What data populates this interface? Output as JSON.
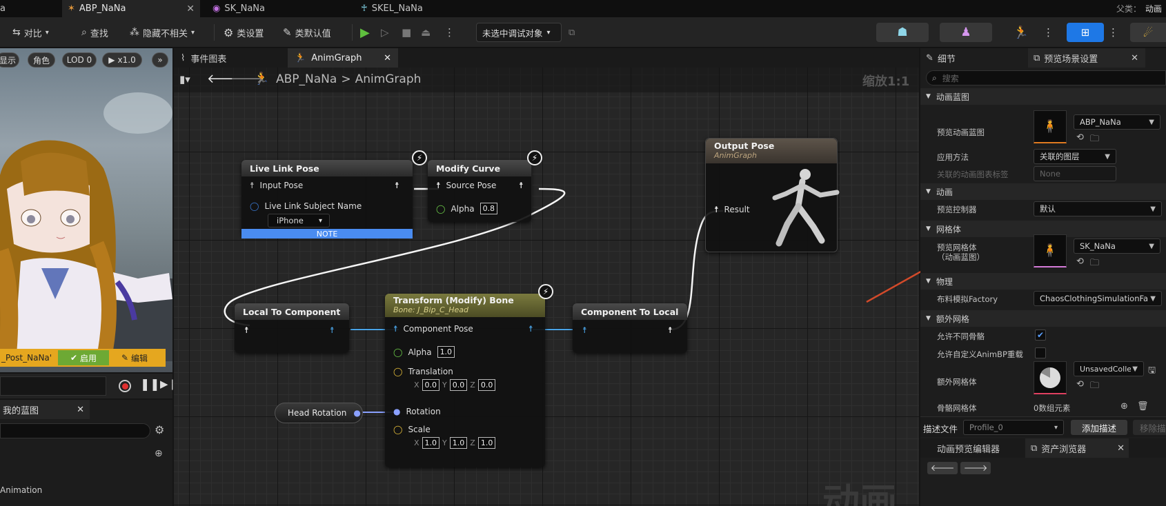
{
  "doc_tabs": [
    {
      "label": "ABP_NaNa"
    },
    {
      "label": "SK_NaNa"
    },
    {
      "label": "SKEL_NaNa"
    }
  ],
  "tab_fragment_left": "a",
  "parent_label": "父类：",
  "parent_value": "动画",
  "toolbar": {
    "compare": "对比",
    "find": "查找",
    "hide_unrelated": "隐藏不相关",
    "class_settings": "类设置",
    "class_defaults": "类默认值",
    "debug_object": "未选中调试对象"
  },
  "viewport": {
    "show": "显示",
    "character": "角色",
    "lod": "LOD 0",
    "speed": "x1.0",
    "post_name": "_Post_NaNa'",
    "enable": "启用",
    "edit": "编辑"
  },
  "my_blueprint": {
    "title": "我的蓝图",
    "animation_item": "Animation"
  },
  "graph": {
    "tabs": [
      {
        "label": "事件图表"
      },
      {
        "label": "AnimGraph"
      }
    ],
    "crumb_root": "ABP_NaNa",
    "crumb_sep": ">",
    "crumb_leaf": "AnimGraph",
    "zoom": "缩放1:1",
    "watermark": "动画",
    "nodes": {
      "live_link": {
        "title": "Live Link Pose",
        "input_pose": "Input Pose",
        "subject_label": "Live Link Subject Name",
        "subject_value": "iPhone",
        "note": "NOTE"
      },
      "modify_curve": {
        "title": "Modify Curve",
        "source_pose": "Source Pose",
        "alpha_label": "Alpha",
        "alpha_value": "0.8"
      },
      "output_pose": {
        "title": "Output Pose",
        "subtitle": "AnimGraph",
        "result": "Result"
      },
      "local_to_component": {
        "title": "Local To Component"
      },
      "transform_bone": {
        "title": "Transform (Modify) Bone",
        "subtitle": "Bone: J_Bip_C_Head",
        "component_pose": "Component Pose",
        "alpha_label": "Alpha",
        "alpha_value": "1.0",
        "translation_label": "Translation",
        "translation": {
          "x": "0.0",
          "y": "0.0",
          "z": "0.0"
        },
        "rotation_label": "Rotation",
        "scale_label": "Scale",
        "scale": {
          "x": "1.0",
          "y": "1.0",
          "z": "1.0"
        }
      },
      "component_to_local": {
        "title": "Component To Local"
      },
      "head_rotation": {
        "title": "Head Rotation"
      }
    }
  },
  "details": {
    "tab_details": "细节",
    "tab_preview": "预览场景设置",
    "search_placeholder": "搜索",
    "sections": {
      "anim_bp": "动画蓝图",
      "animation": "动画",
      "mesh": "网格体",
      "physics": "物理",
      "extra_mesh": "额外网格"
    },
    "props": {
      "preview_anim_bp": "预览动画蓝图",
      "preview_anim_bp_value": "ABP_NaNa",
      "apply_method": "应用方法",
      "apply_method_value": "关联的图层",
      "linked_tag": "关联的动画图表标签",
      "linked_tag_value": "None",
      "preview_controller": "预览控制器",
      "preview_controller_value": "默认",
      "preview_mesh": "预览网格体\n（动画蓝图）",
      "preview_mesh_value": "SK_NaNa",
      "cloth_factory": "布料模拟Factory",
      "cloth_factory_value": "ChaosClothingSimulationFa",
      "allow_diff_skel": "允许不同骨骼",
      "allow_custom_bp": "允许自定义AnimBP重载",
      "extra_mesh": "额外网格体",
      "extra_mesh_value": "UnsavedColle",
      "skel_mesh": "骨骼网格体",
      "skel_mesh_value": "0数组元素"
    },
    "profile_label": "描述文件",
    "profile_value": "Profile_0",
    "add_desc": "添加描述",
    "remove_desc": "移除描",
    "bottom_tab1": "动画预览编辑器",
    "bottom_tab2": "资产浏览器"
  },
  "colors": {
    "arrow": "#d24a2a",
    "note_bar": "#4a8cf0",
    "toolbar_accent": "#1e78e6",
    "viewport_gold": "#e5a71f",
    "enable_green": "#6da934"
  }
}
